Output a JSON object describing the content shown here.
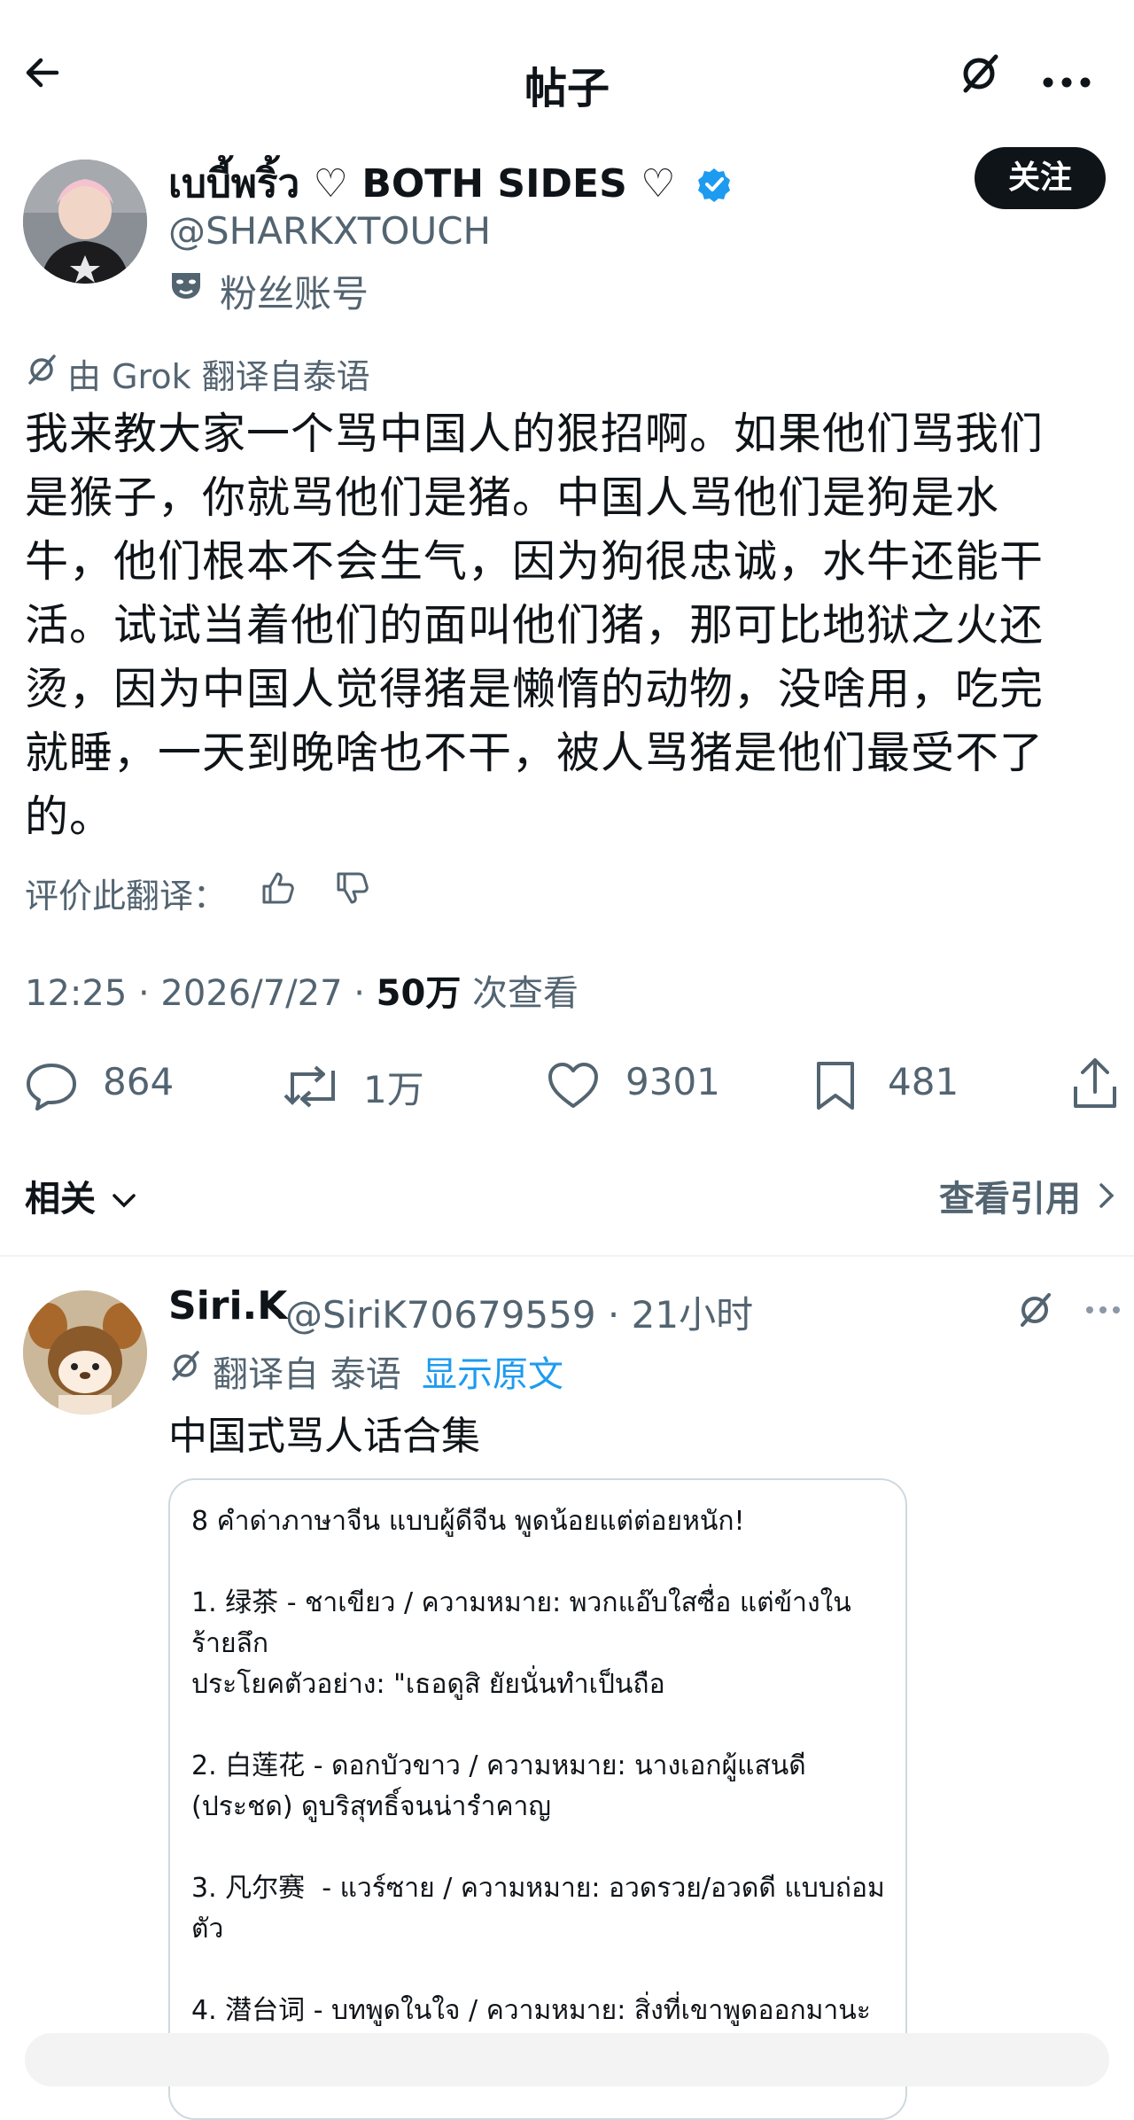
{
  "header": {
    "title": "帖子"
  },
  "post": {
    "author": {
      "name": "เบบี้พริ้ว ♡ BOTH SIDES ♡",
      "handle": "@SHARKXTOUCH",
      "label": "粉丝账号"
    },
    "follow_label": "关注",
    "translated_by": "由 Grok 翻译自泰语",
    "lines": [
      "我来教大家一个骂中国人的狠招啊。如果他们骂我们",
      "是猴子，你就骂他们是猪。中国人骂他们是狗是水",
      "牛，他们根本不会生气，因为狗很忠诚，水牛还能干",
      "活。试试当着他们的面叫他们猪，那可比地狱之火还",
      "烫，因为中国人觉得猪是懒惰的动物，没啥用，吃完",
      "就睡，一天到晚啥也不干，被人骂猪是他们最受不了",
      "的。"
    ],
    "rate_translation": "评价此翻译：",
    "time_date": "12:25 · 2026/7/27 · ",
    "views_count": "50万",
    "views_label": " 次查看",
    "stats": {
      "replies": "864",
      "reposts": "1万",
      "likes": "9301",
      "bookmarks": "481"
    }
  },
  "related_label": "相关",
  "view_quotes_label": "查看引用",
  "reply": {
    "name": "Siri.K",
    "handle_time": "@SiriK70679559 · 21小时",
    "translated_from": "翻译自 泰语",
    "show_original": "显示原文",
    "text": "中国式骂人话合集",
    "card_text": "8 คำด่าภาษาจีน แบบผู้ดีจีน พูดน้อยแต่ต่อยหนัก!\n\n1. 绿茶 - ชาเขียว / ความหมาย: พวกแอ๊บใสซื่อ แต่ข้างใน\nร้ายลึก\nประโยคตัวอย่าง: \"เธอดูสิ ยัยนั่นทำเป็นถือ\n\n2. 白莲花 - ดอกบัวขาว / ความหมาย: นางเอกผู้แสนดี\n(ประชด) ดูบริสุทธิ์จนน่ารำคาญ\n\n3. 凡尔赛  - แวร์ซาย / ความหมาย: อวดรวย/อวดดี แบบถ่อม\nตัว\n\n4. 潜台词 - บทพูดในใจ / ความหมาย: สิ่งที่เขาพูดออกมานะ"
  },
  "colors": {
    "accent": "#1d9bf0",
    "text": "#0f1419",
    "muted": "#536471",
    "verified": "#1d9bf0"
  }
}
